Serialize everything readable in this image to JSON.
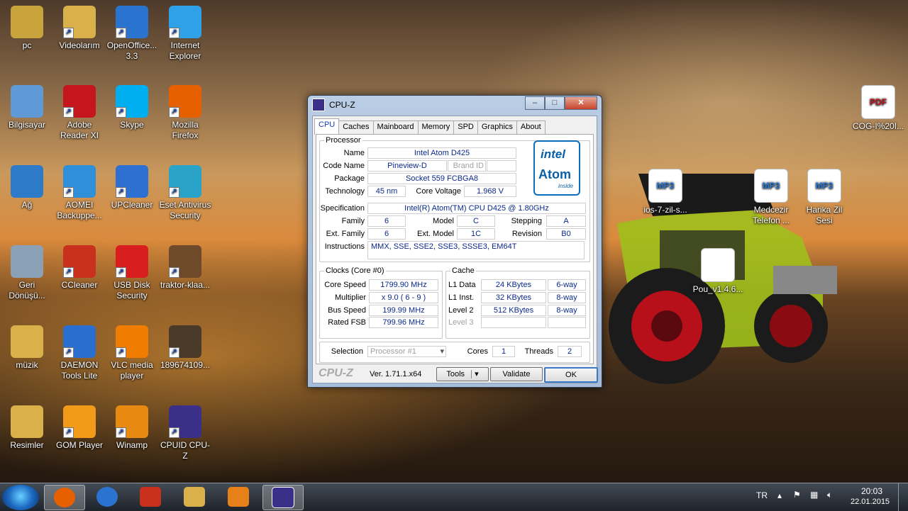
{
  "desktop": {
    "icons": [
      {
        "label": "pc",
        "color": "#c9a43c"
      },
      {
        "label": "Videolarım",
        "color": "#d9b04a"
      },
      {
        "label": "OpenOffice... 3.3",
        "color": "#2a74d0"
      },
      {
        "label": "Internet Explorer",
        "color": "#2ea1e8"
      },
      {
        "label": "Bilgisayar",
        "color": "#5f9ad6"
      },
      {
        "label": "Adobe Reader XI",
        "color": "#c4161c"
      },
      {
        "label": "Skype",
        "color": "#00aff0"
      },
      {
        "label": "Mozilla Firefox",
        "color": "#e66000"
      },
      {
        "label": "Ağ",
        "color": "#2d7bc8"
      },
      {
        "label": "AOMEI Backuppe...",
        "color": "#2f8fd8"
      },
      {
        "label": "UPCleaner",
        "color": "#2e6fd2"
      },
      {
        "label": "Eset Antivirus Security",
        "color": "#2aa3c8"
      },
      {
        "label": "Geri Dönüşü...",
        "color": "#8aa0b4"
      },
      {
        "label": "CCleaner",
        "color": "#c9311e"
      },
      {
        "label": "USB Disk Security",
        "color": "#d81e1e"
      },
      {
        "label": "traktor-klaa...",
        "color": "#6e4a2a"
      },
      {
        "label": "müzik",
        "color": "#d9b04a"
      },
      {
        "label": "DAEMON Tools Lite",
        "color": "#2a6fd0"
      },
      {
        "label": "VLC media player",
        "color": "#f07c00"
      },
      {
        "label": "189674109...",
        "color": "#4a3a2a"
      },
      {
        "label": "Resimler",
        "color": "#d9b04a"
      },
      {
        "label": "GOM Player",
        "color": "#f29a1a"
      },
      {
        "label": "Winamp",
        "color": "#e88a12"
      },
      {
        "label": "CPUID CPU-Z",
        "color": "#3b3089"
      }
    ],
    "right_icons": [
      {
        "label": "COG-I%20I...",
        "kind": "PDF"
      },
      {
        "label": "ios-7-zil-s...",
        "kind": "MP3"
      },
      {
        "label": "Medcezir Telefon ...",
        "kind": "MP3"
      },
      {
        "label": "Harika Zil Sesi",
        "kind": "MP3"
      },
      {
        "label": "Pou_v1.4.6...",
        "kind": "file"
      }
    ]
  },
  "window": {
    "title": "CPU-Z",
    "controls": {
      "min": "–",
      "max": "□",
      "close": "✕"
    },
    "tabs": [
      "CPU",
      "Caches",
      "Mainboard",
      "Memory",
      "SPD",
      "Graphics",
      "About"
    ],
    "active_tab": "CPU",
    "processor": {
      "legend": "Processor",
      "name_label": "Name",
      "name": "Intel Atom D425",
      "codename_label": "Code Name",
      "codename": "Pineview-D",
      "brandid_label": "Brand ID",
      "package_label": "Package",
      "package": "Socket 559 FCBGA8",
      "technology_label": "Technology",
      "technology": "45 nm",
      "voltage_label": "Core Voltage",
      "voltage": "1.968 V",
      "spec_label": "Specification",
      "spec": "Intel(R) Atom(TM) CPU D425   @ 1.80GHz",
      "family_label": "Family",
      "family": "6",
      "model_label": "Model",
      "model": "C",
      "stepping_label": "Stepping",
      "stepping": "A",
      "extfamily_label": "Ext. Family",
      "extfamily": "6",
      "extmodel_label": "Ext. Model",
      "extmodel": "1C",
      "revision_label": "Revision",
      "revision": "B0",
      "instructions_label": "Instructions",
      "instructions": "MMX, SSE, SSE2, SSE3, SSSE3, EM64T",
      "logo": {
        "brand": "intel",
        "product": "Atom",
        "tag": "inside"
      }
    },
    "clocks": {
      "legend": "Clocks (Core #0)",
      "core_speed_label": "Core Speed",
      "core_speed": "1799.90 MHz",
      "multiplier_label": "Multiplier",
      "multiplier": "x 9.0 ( 6 - 9 )",
      "bus_speed_label": "Bus Speed",
      "bus_speed": "199.99 MHz",
      "rated_fsb_label": "Rated FSB",
      "rated_fsb": "799.96 MHz"
    },
    "cache": {
      "legend": "Cache",
      "l1data_label": "L1 Data",
      "l1data": "24 KBytes",
      "l1data_way": "6-way",
      "l1inst_label": "L1 Inst.",
      "l1inst": "32 KBytes",
      "l1inst_way": "8-way",
      "level2_label": "Level 2",
      "level2": "512 KBytes",
      "level2_way": "8-way",
      "level3_label": "Level 3"
    },
    "selection_label": "Selection",
    "selection": "Processor #1",
    "cores_label": "Cores",
    "cores": "1",
    "threads_label": "Threads",
    "threads": "2",
    "brand": "CPU-Z",
    "version": "Ver. 1.71.1.x64",
    "tools_label": "Tools",
    "validate_label": "Validate",
    "ok_label": "OK"
  },
  "taskbar": {
    "language": "TR",
    "time": "20:03",
    "date": "22.01.2015",
    "apps": [
      "firefox",
      "openoffice",
      "ccleaner",
      "explorer",
      "media-player",
      "cpu-z"
    ]
  }
}
